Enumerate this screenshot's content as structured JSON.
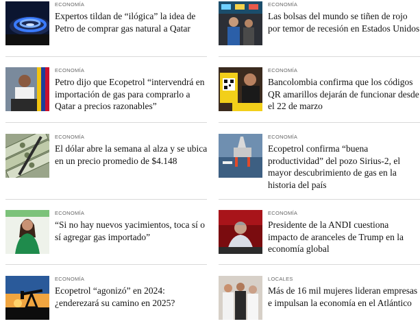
{
  "articles": [
    {
      "category": "ECONOMÍA",
      "headline": "Expertos tildan de “ilógica” la idea de Petro de comprar gas natural a Qatar",
      "thumb": "gas-flame"
    },
    {
      "category": "ECONOMÍA",
      "headline": "Las bolsas del mundo se tiñen de rojo por temor de recesión en Estados Unidos",
      "thumb": "stock-traders"
    },
    {
      "category": "ECONOMÍA",
      "headline": "Petro dijo que Ecopetrol “intervendrá en importación de gas para comprarlo a Qatar a precios razonables”",
      "thumb": "president-podium"
    },
    {
      "category": "ECONOMÍA",
      "headline": "Bancolombia confirma que los códigos QR amarillos dejarán de funcionar desde el 22 de marzo",
      "thumb": "qr-code-sign"
    },
    {
      "category": "ECONOMÍA",
      "headline": "El dólar abre la semana al alza y se ubica en un precio promedio de $4.148",
      "thumb": "dollar-bills"
    },
    {
      "category": "ECONOMÍA",
      "headline": "Ecopetrol confirma “buena productividad” del pozo Sirius-2, el mayor descubrimiento de gas en la historia del país",
      "thumb": "offshore-rig"
    },
    {
      "category": "ECONOMÍA",
      "headline": "“Si no hay nuevos yacimientos, toca sí o sí agregar gas importado”",
      "thumb": "woman-portrait"
    },
    {
      "category": "ECONOMÍA",
      "headline": "Presidente de la ANDI cuestiona impacto de aranceles de Trump en la economía global",
      "thumb": "speaker-stage"
    },
    {
      "category": "ECONOMÍA",
      "headline": "Ecopetrol “agonizó” en 2024: ¿enderezará su camino en 2025?",
      "thumb": "pumpjack-sunset"
    },
    {
      "category": "LOCALES",
      "headline": "Más de 16 mil mujeres lideran empresas e impulsan la economía en el Atlántico",
      "thumb": "women-group"
    }
  ]
}
